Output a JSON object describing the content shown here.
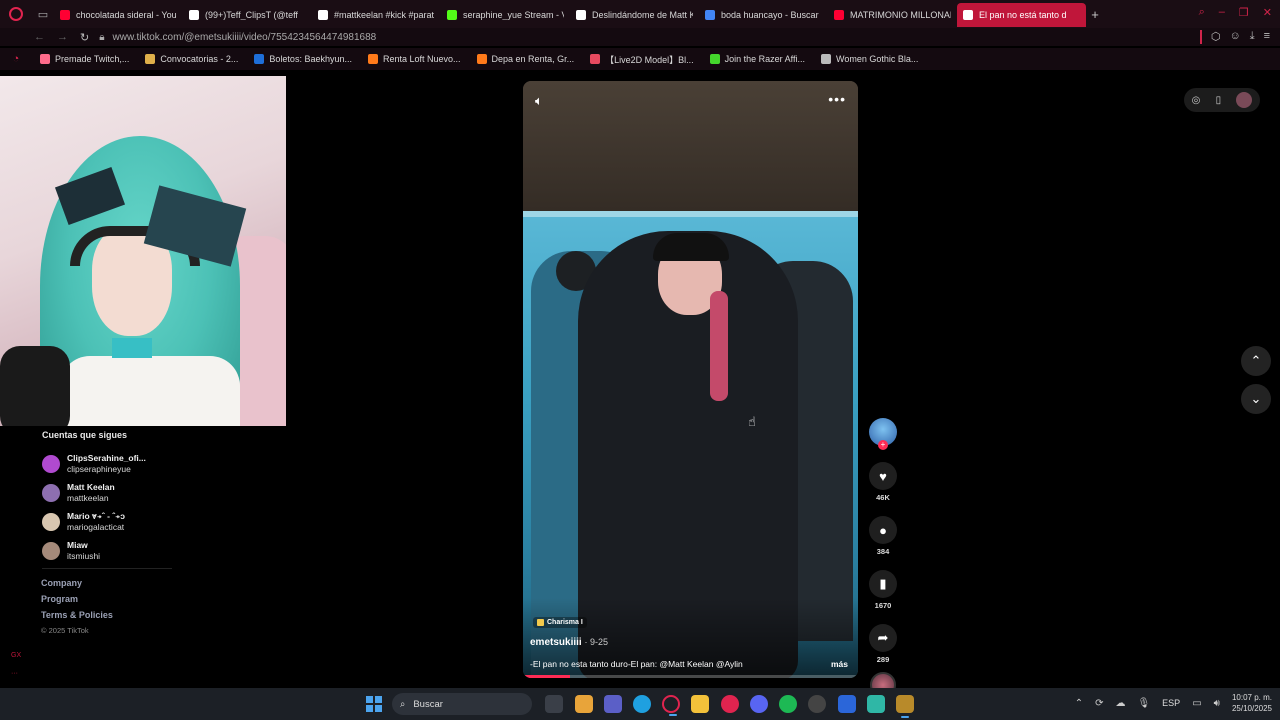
{
  "browser": {
    "tabs": [
      {
        "label": "chocolatada sideral - You",
        "color": "#ff0033"
      },
      {
        "label": "(99+)Teff_ClipsT (@teff",
        "color": "#ffffff"
      },
      {
        "label": "#mattkeelan #kick #parat",
        "color": "#ffffff"
      },
      {
        "label": "seraphine_yue Stream - V",
        "color": "#53fc18"
      },
      {
        "label": "Deslindándome de Matt K",
        "color": "#ffffff"
      },
      {
        "label": "boda huancayo - Buscar",
        "color": "#4285f4"
      },
      {
        "label": "MATRIMONIO MILLONAR",
        "color": "#ff0033"
      },
      {
        "label": "El pan no está tanto d",
        "color": "#ffffff"
      }
    ],
    "url": "www.tiktok.com/@emetsukiiii/video/7554234564474981688",
    "bookmarks": [
      {
        "label": "Premade Twitch,...",
        "color": "#ff6b8b"
      },
      {
        "label": "Convocatorias - 2...",
        "color": "#e0b04a"
      },
      {
        "label": "Boletos: Baekhyun...",
        "color": "#1e6fd9"
      },
      {
        "label": "Renta Loft Nuevo...",
        "color": "#ff7a1a"
      },
      {
        "label": "Depa en Renta, Gr...",
        "color": "#ff7a1a"
      },
      {
        "label": "【Live2D Model】Bl...",
        "color": "#e84a5f"
      },
      {
        "label": "Join the Razer Affi...",
        "color": "#44d62c"
      },
      {
        "label": "Women Gothic Bla...",
        "color": "#bbbbbb"
      }
    ]
  },
  "sidebar": {
    "following_title": "Cuentas que sigues",
    "accounts": [
      {
        "name": "ClipsSerahine_ofi...",
        "handle": "clipseraphineyue",
        "color": "#b04ad0"
      },
      {
        "name": "Matt Keelan",
        "handle": "mattkeelan",
        "color": "#8d6fb0"
      },
      {
        "name": "Mario ⩔⍆ˆ - ˆ⍆ɔ",
        "handle": "mariogalacticat",
        "color": "#d8c6b0"
      },
      {
        "name": "Miaw",
        "handle": "itsmiushi",
        "color": "#a58a7a"
      }
    ],
    "footer": [
      "Company",
      "Program",
      "Terms & Policies"
    ],
    "copyright": "© 2025 TikTok",
    "strip_text": "GX"
  },
  "video": {
    "badge": "Charisma I",
    "author": "emetsukiiii",
    "date": "· 9-25",
    "description": "-El pan no esta tanto duro-El pan: @Matt Keelan @Aylin",
    "more": "más",
    "progress": 0.14
  },
  "actions": {
    "likes": "46K",
    "comments": "384",
    "saves": "1670",
    "shares": "289"
  },
  "taskbar": {
    "search": "Buscar",
    "lang": "ESP",
    "time": "10:07 p. m.",
    "date": "25/10/2025"
  },
  "colors": {
    "accent": "#fe2c55",
    "opera_red": "#c0163a"
  }
}
